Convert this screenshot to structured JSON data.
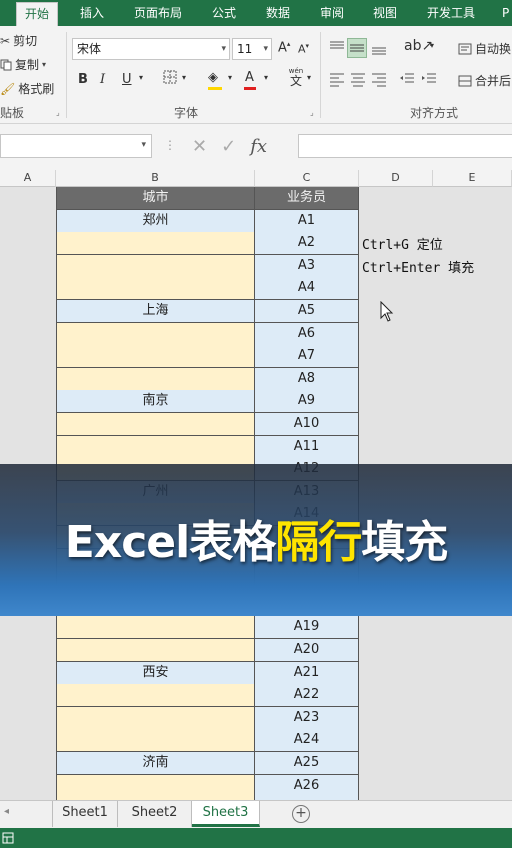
{
  "ribbon_tabs": [
    "开始",
    "插入",
    "页面布局",
    "公式",
    "数据",
    "审阅",
    "视图",
    "开发工具",
    "P"
  ],
  "clipboard": {
    "cut_label": "剪切",
    "copy_label": "复制",
    "format_painter_label": "格式刷",
    "group_label": "贴板"
  },
  "font": {
    "font_name": "宋体",
    "font_size": "11",
    "grow_label": "A",
    "shrink_label": "A",
    "bold": "B",
    "italic": "I",
    "underline": "U",
    "font_color": "A",
    "phonetic": "wén",
    "phonetic_char": "文",
    "group_label": "字体"
  },
  "alignment": {
    "wrap_label": "自动换",
    "merge_label": "合并后",
    "group_label": "对齐方式"
  },
  "columns": [
    "A",
    "B",
    "C",
    "D",
    "E"
  ],
  "table": {
    "headers": [
      "城市",
      "业务员"
    ],
    "rows": [
      {
        "city": "郑州",
        "rep": "A1"
      },
      {
        "city": "",
        "rep": "A2"
      },
      {
        "city": "",
        "rep": "A3"
      },
      {
        "city": "",
        "rep": "A4"
      },
      {
        "city": "上海",
        "rep": "A5"
      },
      {
        "city": "",
        "rep": "A6"
      },
      {
        "city": "",
        "rep": "A7"
      },
      {
        "city": "",
        "rep": "A8"
      },
      {
        "city": "南京",
        "rep": "A9"
      },
      {
        "city": "",
        "rep": "A10"
      },
      {
        "city": "",
        "rep": "A11"
      },
      {
        "city": "",
        "rep": "A12"
      },
      {
        "city": "广州",
        "rep": "A13"
      },
      {
        "city": "",
        "rep": "A14"
      },
      {
        "city": "",
        "rep": ""
      },
      {
        "city": "",
        "rep": ""
      },
      {
        "city": "",
        "rep": ""
      },
      {
        "city": "",
        "rep": ""
      },
      {
        "city": "",
        "rep": "A19"
      },
      {
        "city": "",
        "rep": "A20"
      },
      {
        "city": "西安",
        "rep": "A21"
      },
      {
        "city": "",
        "rep": "A22"
      },
      {
        "city": "",
        "rep": "A23"
      },
      {
        "city": "",
        "rep": "A24"
      },
      {
        "city": "济南",
        "rep": "A25"
      },
      {
        "city": "",
        "rep": "A26"
      },
      {
        "city": "",
        "rep": ""
      }
    ]
  },
  "notes": [
    "Ctrl+G 定位",
    "Ctrl+Enter 填充"
  ],
  "banner": {
    "text_before": "Excel表格",
    "text_highlight": "隔行",
    "text_after": "填充"
  },
  "sheet_tabs": [
    "Sheet1",
    "Sheet2",
    "Sheet3"
  ],
  "active_sheet": "Sheet3",
  "colors": {
    "excel_green": "#217346",
    "header_gray": "#6b6b6b",
    "city_row_blue": "#ddebf7",
    "empty_row_yellow": "#fff2cc",
    "banner_highlight": "#ffe400"
  }
}
